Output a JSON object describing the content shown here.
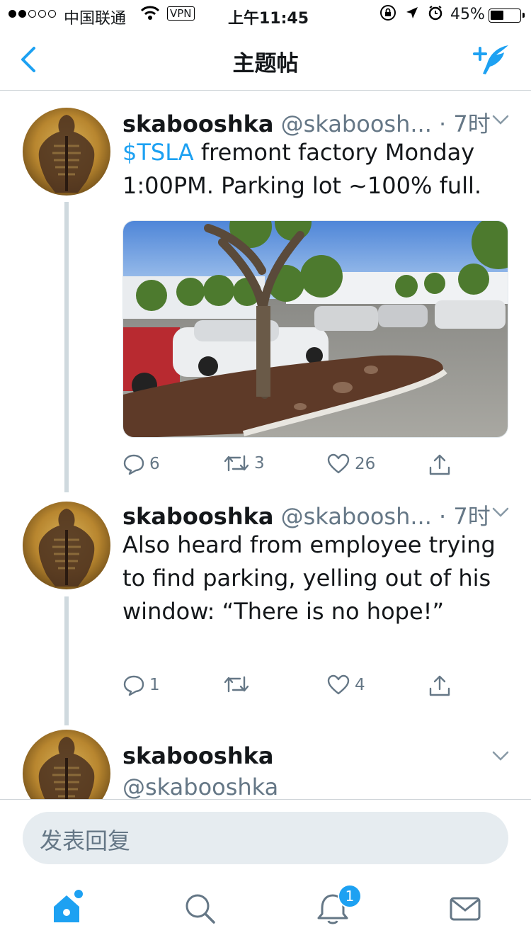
{
  "status_bar": {
    "carrier": "中国联通",
    "vpn": "VPN",
    "time": "上午11:45",
    "battery": "45%",
    "battery_level": 0.45
  },
  "nav": {
    "title": "主题帖",
    "back_icon": "chevron-left-icon",
    "compose_icon": "compose-tweet-icon"
  },
  "tweets": [
    {
      "name": "skabooshka",
      "handle": "@skaboosh...",
      "time": "· 7时",
      "text_cashtag": "$TSLA",
      "text": " fremont factory Monday 1:00PM. Parking lot ~100% full.",
      "actions": {
        "replies": "6",
        "retweets": "3",
        "likes": "26"
      }
    },
    {
      "name": "skabooshka",
      "handle": "@skaboosh...",
      "time": "· 7时",
      "text": "Also heard from employee trying to find parking, yelling out of his window: “There is no hope!”",
      "actions": {
        "replies": "1",
        "retweets": "",
        "likes": "4"
      }
    },
    {
      "name": "skabooshka",
      "handle": "@skabooshka"
    }
  ],
  "reply": {
    "placeholder": "发表回复"
  },
  "tabbar": {
    "items": [
      "home-icon",
      "search-icon",
      "notifications-icon",
      "messages-icon"
    ],
    "notification_badge": "1"
  },
  "colors": {
    "accent": "#1da1f2",
    "muted": "#657786",
    "thread_line": "#cfd9de"
  }
}
